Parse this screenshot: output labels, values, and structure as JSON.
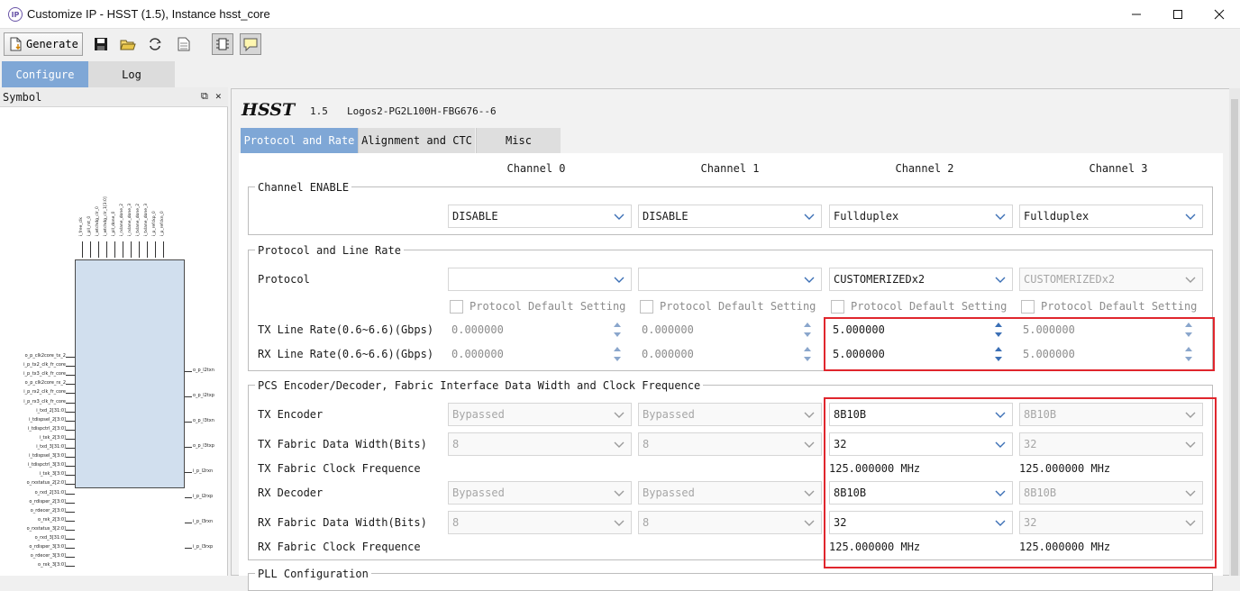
{
  "window": {
    "title": "Customize IP - HSST (1.5), Instance hsst_core",
    "icon_text": "IP",
    "controls": [
      "minimize-icon",
      "maximize-icon",
      "close-icon"
    ]
  },
  "toolbar": {
    "generate_label": "Generate",
    "icons": [
      "save-icon",
      "open-folder-icon",
      "refresh-icon",
      "document-icon",
      "chip-view-icon",
      "comment-icon"
    ]
  },
  "top_tabs": {
    "configure": "Configure",
    "log": "Log"
  },
  "symbol_panel": {
    "title": "Symbol",
    "top_pins": [
      "i_free_clk",
      "i_pll_rst_0",
      "i_wtchdg_clr_0",
      "i_wtchdg_clr_1[3:0]",
      "i_pll_done_0",
      "i_rxlane_done_2",
      "i_rxlane_done_3",
      "i_txlane_done_2",
      "i_txlane_done_3",
      "i_p_refckp_0",
      "i_p_refckn_0"
    ],
    "left_pins": [
      "o_p_clk2core_tx_2",
      "i_p_tx2_clk_fr_core",
      "i_p_tx3_clk_fr_core",
      "o_p_clk2core_rx_2",
      "i_p_rx2_clk_fr_core",
      "i_p_rx3_clk_fr_core",
      "i_txd_2[31:0]",
      "i_tdispsel_2[3:0]",
      "i_tdispctrl_2[3:0]",
      "i_txk_2[3:0]",
      "i_txd_3[31:0]",
      "i_tdispsel_3[3:0]",
      "i_tdispctrl_3[3:0]",
      "i_txk_3[3:0]",
      "o_rxstatus_2[2:0]",
      "o_rxd_2[31:0]",
      "o_rdisper_2[3:0]",
      "o_rdecer_2[3:0]",
      "o_rxk_2[3:0]",
      "o_rxstatus_3[2:0]",
      "o_rxd_3[31:0]",
      "o_rdisper_3[3:0]",
      "o_rdecer_3[3:0]",
      "o_rxk_3[3:0]"
    ],
    "right_pins": [
      "o_p_l2txn",
      "o_p_l2txp",
      "o_p_l3txn",
      "o_p_l3txp",
      "i_p_l2rxn",
      "i_p_l2rxp",
      "i_p_l3rxn",
      "i_p_l3rxp"
    ]
  },
  "header": {
    "name": "HSST",
    "version": "1.5",
    "part": "Logos2-PG2L100H-FBG676--6"
  },
  "tabs": [
    "Protocol and Rate",
    "Alignment and CTC",
    "Misc"
  ],
  "channels": [
    "Channel 0",
    "Channel 1",
    "Channel 2",
    "Channel 3"
  ],
  "channel_enable": {
    "title": "Channel ENABLE",
    "values": [
      "DISABLE",
      "DISABLE",
      "Fullduplex",
      "Fullduplex"
    ]
  },
  "protocol_rate": {
    "title": "Protocol and Line Rate",
    "protocol_label": "Protocol",
    "protocol_values": [
      "",
      "",
      "CUSTOMERIZEDx2",
      "CUSTOMERIZEDx2"
    ],
    "default_setting_label": "Protocol Default Setting",
    "tx_rate_label": "TX Line Rate(0.6~6.6)(Gbps)",
    "tx_rate_values": [
      "0.000000",
      "0.000000",
      "5.000000",
      "5.000000"
    ],
    "rx_rate_label": "RX Line Rate(0.6~6.6)(Gbps)",
    "rx_rate_values": [
      "0.000000",
      "0.000000",
      "5.000000",
      "5.000000"
    ]
  },
  "pcs": {
    "title": "PCS Encoder/Decoder, Fabric Interface Data Width and Clock Frequence",
    "tx_encoder_label": "TX Encoder",
    "tx_encoder_values": [
      "Bypassed",
      "Bypassed",
      "8B10B",
      "8B10B"
    ],
    "tx_width_label": "TX Fabric Data Width(Bits)",
    "tx_width_values": [
      "8",
      "8",
      "32",
      "32"
    ],
    "tx_clock_label": "TX Fabric Clock Frequence",
    "tx_clock_values": [
      "",
      "",
      "125.000000 MHz",
      "125.000000 MHz"
    ],
    "rx_decoder_label": "RX Decoder",
    "rx_decoder_values": [
      "Bypassed",
      "Bypassed",
      "8B10B",
      "8B10B"
    ],
    "rx_width_label": "RX Fabric Data Width(Bits)",
    "rx_width_values": [
      "8",
      "8",
      "32",
      "32"
    ],
    "rx_clock_label": "RX Fabric Clock Frequence",
    "rx_clock_values": [
      "",
      "",
      "125.000000 MHz",
      "125.000000 MHz"
    ]
  },
  "pll": {
    "title": "PLL Configuration"
  },
  "colors": {
    "accent_tab": "#7fa7d6",
    "highlight": "#e0262d",
    "symbol_fill": "#d1dfee"
  }
}
